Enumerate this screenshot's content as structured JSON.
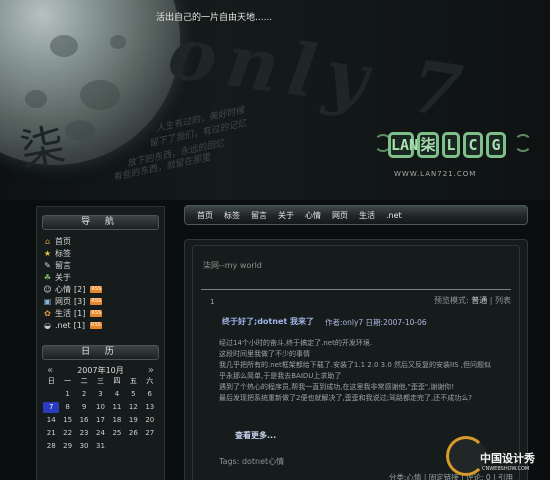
{
  "header": {
    "slogan": "活出自己的一片自由天地......",
    "bg_text": "only 7",
    "bg_cn": "柒",
    "poem_lines": [
      "人生有过的，美好时候",
      "留下了我们，有过的记忆",
      "放下的东西，永远的回忆",
      "有些的东西，就留在那里"
    ],
    "logo_letters": [
      "LAN",
      "柒",
      "L",
      "C",
      "G"
    ],
    "logo_url": "WWW.LAN721.COM"
  },
  "sidebar": {
    "nav_title": "导 航",
    "nav_items": [
      {
        "icon": "home-icon",
        "glyph": "⌂",
        "color": "#d9a23b",
        "label": "首页",
        "count": "",
        "rss": false
      },
      {
        "icon": "star-icon",
        "glyph": "★",
        "color": "#e8c83a",
        "label": "标签",
        "count": "",
        "rss": false
      },
      {
        "icon": "guestbook-icon",
        "glyph": "✎",
        "color": "#cfd8e8",
        "label": "留言",
        "count": "",
        "rss": false
      },
      {
        "icon": "about-icon",
        "glyph": "☘",
        "color": "#7fc46a",
        "label": "关于",
        "count": "",
        "rss": false
      },
      {
        "icon": "mood-icon",
        "glyph": "☺",
        "color": "#e0e0e0",
        "label": "心情",
        "count": "[2]",
        "rss": true
      },
      {
        "icon": "web-icon",
        "glyph": "▣",
        "color": "#8fb4d8",
        "label": "网页",
        "count": "[3]",
        "rss": true
      },
      {
        "icon": "life-icon",
        "glyph": "✿",
        "color": "#e69a3c",
        "label": "生活",
        "count": "[1]",
        "rss": true
      },
      {
        "icon": "dotnet-icon",
        "glyph": "◒",
        "color": "#c8c8c8",
        "label": ".net",
        "count": "[1]",
        "rss": true
      }
    ],
    "rss_label": "RSS",
    "cal_title": "日 历",
    "calendar": {
      "prev": "«",
      "next": "»",
      "month_label": "2007年10月",
      "weekdays": [
        "日",
        "一",
        "二",
        "三",
        "四",
        "五",
        "六"
      ],
      "days": [
        "",
        "1",
        "2",
        "3",
        "4",
        "5",
        "6",
        "7",
        "8",
        "9",
        "10",
        "11",
        "12",
        "13",
        "14",
        "15",
        "16",
        "17",
        "18",
        "19",
        "20",
        "21",
        "22",
        "23",
        "24",
        "25",
        "26",
        "27",
        "28",
        "29",
        "30",
        "31",
        "",
        "",
        ""
      ],
      "highlight_day": "7"
    }
  },
  "navbar": {
    "items": [
      "首页",
      "标签",
      "留言",
      "关于",
      "心情",
      "网页",
      "生活",
      ".net"
    ]
  },
  "main": {
    "crumb": "柒网--my world",
    "post_index": "1",
    "mode_label": "预览模式: ",
    "mode_normal": "普通",
    "mode_sep": " | ",
    "mode_list": "列表",
    "post_title": "终于好了;dotnet 我来了",
    "post_meta": "作者:only7 日期:2007-10-06",
    "body_lines": [
      "经过14个小时的奋斗,终于搞定了.net的开发环境.",
      "这段时间里我做了不少的事情",
      "我几乎把所有的.net框架都给下载了.安装了1.1 2.0 3.0 然后又反复的安装IIS ,但问题似",
      "乎永那么简单,于是我去BAIDU上求助了",
      "遇到了个热心的程序员,帮我一直到成功,在这里我非常感谢他,\"歪歪\",谢谢你!",
      "最后发现把系统重新做了2便也就解决了,歪歪和我说过;驾路都走完了,还不成功么?"
    ],
    "more": "查看更多...",
    "tags": "Tags: dotnet心情",
    "footer": "分类:心情 | 固定链接 | 评论: 0 | 引用"
  },
  "watermark": {
    "cn": "中国设计秀",
    "en": "CNWEBSHOW.COM"
  }
}
